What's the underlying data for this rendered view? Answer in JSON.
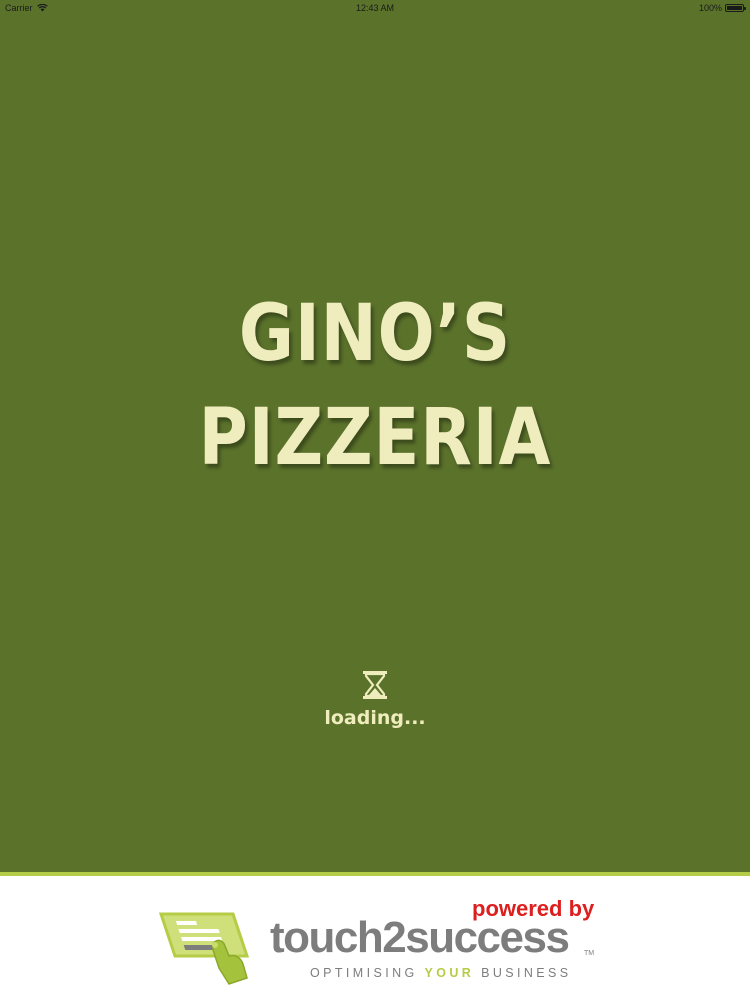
{
  "status_bar": {
    "carrier": "Carrier",
    "time": "12:43 AM",
    "battery": "100%",
    "battery_level": 1.0
  },
  "splash": {
    "title_line1": "GINO’S",
    "title_line2": "PIZZERIA",
    "loading_text": "loading...",
    "loading_icon": "hourglass-icon"
  },
  "footer": {
    "powered_by": "powered by",
    "brand": "touch2success",
    "trademark": "TM",
    "tagline_before": "OPTIMISING ",
    "tagline_highlight": "YOUR",
    "tagline_after": " BUSINESS",
    "logo_icon": "card-payment-hand-icon"
  },
  "colors": {
    "background": "#5b722b",
    "title": "#efedbd",
    "footer_accent": "#b5cc46",
    "powered_by": "#dd1f1f",
    "brand_gray": "#7d7d7d"
  }
}
